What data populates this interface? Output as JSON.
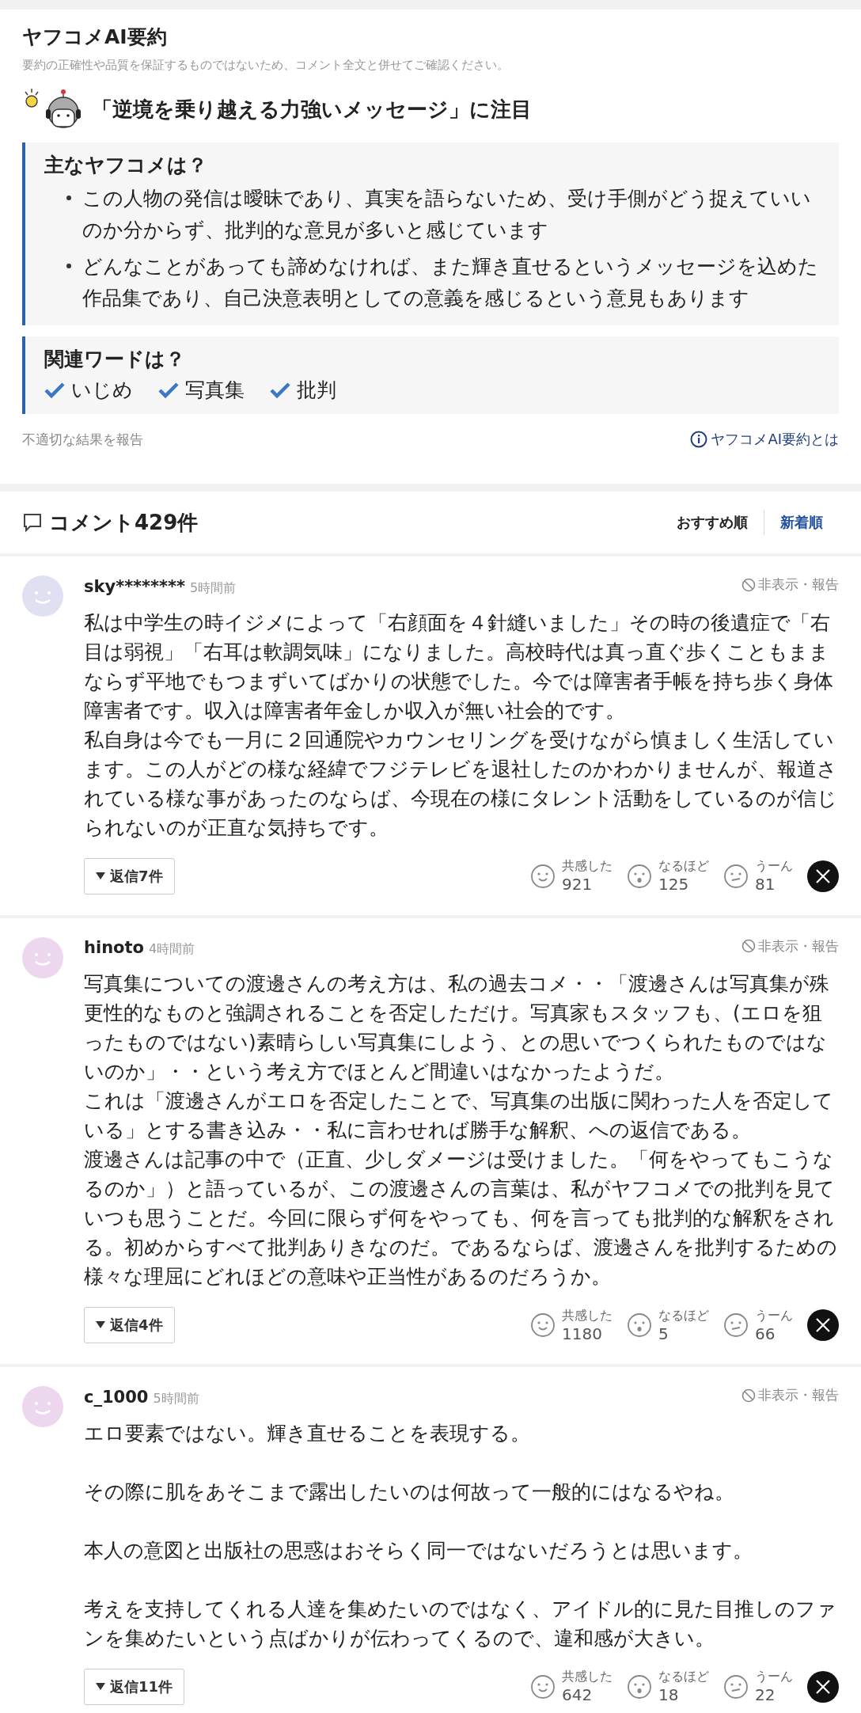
{
  "summary": {
    "title": "ヤフコメAI要約",
    "disclaimer": "要約の正確性や品質を保証するものではないため、コメント全文と併せてご確認ください。",
    "headline": "「逆境を乗り越える力強いメッセージ」に注目",
    "main_box": {
      "heading": "主なヤフコメは？",
      "bullets": [
        "この人物の発信は曖昧であり、真実を語らないため、受け手側がどう捉えていいのか分からず、批判的な意見が多いと感じています",
        "どんなことがあっても諦めなければ、また輝き直せるというメッセージを込めた作品集であり、自己決意表明としての意義を感じるという意見もあります"
      ]
    },
    "keywords_box": {
      "heading": "関連ワードは？",
      "keywords": [
        "いじめ",
        "写真集",
        "批判"
      ]
    },
    "report_link": "不適切な結果を報告",
    "about_link": "ヤフコメAI要約とは"
  },
  "comments_header": {
    "title": "コメント429件",
    "sort_options": [
      {
        "label": "おすすめ順",
        "selected": false
      },
      {
        "label": "新着順",
        "selected": true
      }
    ]
  },
  "comments": [
    {
      "user": "sky********",
      "time": "5時間前",
      "color": "#dfe1f3",
      "hide_report": "非表示・報告",
      "paragraphs": [
        "私は中学生の時イジメによって「右顔面を４針縫いました」その時の後遺症で「右目は弱視」「右耳は軟調気味」になりました。高校時代は真っ直ぐ歩くこともままならず平地でもつまずいてばかりの状態でした。今では障害者手帳を持ち歩く身体障害者です。収入は障害者年金しか収入が無い社会的です。",
        "私自身は今でも一月に２回通院やカウンセリングを受けながら慎ましく生活しています。この人がどの様な経緯でフジテレビを退社したのかわかりませんが、報道されている様な事があったのならば、今現在の様にタレント活動をしているのが信じられないのが正直な気持ちです。"
      ],
      "replies": "返信7件",
      "reactions": [
        {
          "kind": "empathy",
          "label": "共感した",
          "count": "921"
        },
        {
          "kind": "insight",
          "label": "なるほど",
          "count": "125"
        },
        {
          "kind": "doubt",
          "label": "うーん",
          "count": "81"
        }
      ]
    },
    {
      "user": "hinoto",
      "time": "4時間前",
      "color": "#ecd7ef",
      "hide_report": "非表示・報告",
      "paragraphs": [
        "写真集についての渡邊さんの考え方は、私の過去コメ・・「渡邊さんは写真集が殊更性的なものと強調されることを否定しただけ。写真家もスタッフも、(エロを狙ったものではない)素晴らしい写真集にしよう、との思いでつくられたものではないのか」・・という考え方でほとんど間違いはなかったようだ。",
        "これは「渡邊さんがエロを否定したことで、写真集の出版に関わった人を否定している」とする書き込み・・私に言わせれば勝手な解釈、への返信である。",
        "渡邊さんは記事の中で（正直、少しダメージは受けました。「何をやってもこうなるのか」）と語っているが、この渡邊さんの言葉は、私がヤフコメでの批判を見ていつも思うことだ。今回に限らず何をやっても、何を言っても批判的な解釈をされる。初めからすべて批判ありきなのだ。であるならば、渡邊さんを批判するための様々な理屈にどれほどの意味や正当性があるのだろうか。"
      ],
      "replies": "返信4件",
      "reactions": [
        {
          "kind": "empathy",
          "label": "共感した",
          "count": "1180"
        },
        {
          "kind": "insight",
          "label": "なるほど",
          "count": "5"
        },
        {
          "kind": "doubt",
          "label": "うーん",
          "count": "66"
        }
      ]
    },
    {
      "user": "c_1000",
      "time": "5時間前",
      "color": "#ecd7ef",
      "hide_report": "非表示・報告",
      "paragraphs": [
        "エロ要素ではない。輝き直せることを表現する。",
        "その際に肌をあそこまで露出したいのは何故って一般的にはなるやね。",
        "本人の意図と出版社の思惑はおそらく同一ではないだろうとは思います。",
        "考えを支持してくれる人達を集めたいのではなく、アイドル的に見た目推しのファンを集めたいという点ばかりが伝わってくるので、違和感が大きい。"
      ],
      "replies": "返信11件",
      "reactions": [
        {
          "kind": "empathy",
          "label": "共感した",
          "count": "642"
        },
        {
          "kind": "insight",
          "label": "なるほど",
          "count": "18"
        },
        {
          "kind": "doubt",
          "label": "うーん",
          "count": "22"
        }
      ]
    }
  ]
}
